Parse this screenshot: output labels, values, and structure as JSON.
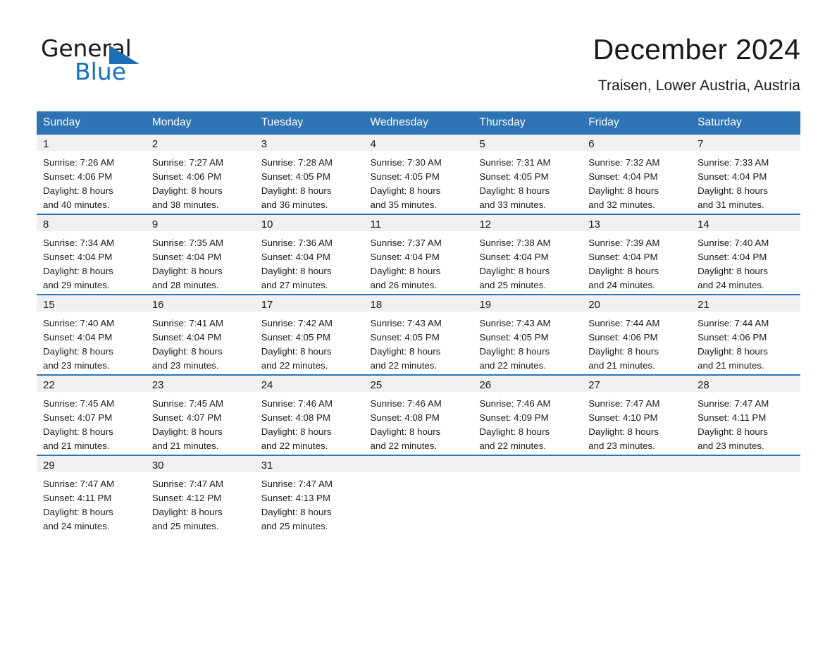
{
  "brand": {
    "name_part1": "General",
    "name_part2": "Blue",
    "accent_color": "#1371c3",
    "flag_color": "#1b6fb4"
  },
  "header": {
    "month_title": "December 2024",
    "location": "Traisen, Lower Austria, Austria"
  },
  "calendar": {
    "header_color": "#2e74b5",
    "date_band_color": "#f0f0f0",
    "weekday_headers": [
      "Sunday",
      "Monday",
      "Tuesday",
      "Wednesday",
      "Thursday",
      "Friday",
      "Saturday"
    ],
    "weeks": [
      [
        {
          "date": "1",
          "detail": "Sunrise: 7:26 AM\nSunset: 4:06 PM\nDaylight: 8 hours\nand 40 minutes."
        },
        {
          "date": "2",
          "detail": "Sunrise: 7:27 AM\nSunset: 4:06 PM\nDaylight: 8 hours\nand 38 minutes."
        },
        {
          "date": "3",
          "detail": "Sunrise: 7:28 AM\nSunset: 4:05 PM\nDaylight: 8 hours\nand 36 minutes."
        },
        {
          "date": "4",
          "detail": "Sunrise: 7:30 AM\nSunset: 4:05 PM\nDaylight: 8 hours\nand 35 minutes."
        },
        {
          "date": "5",
          "detail": "Sunrise: 7:31 AM\nSunset: 4:05 PM\nDaylight: 8 hours\nand 33 minutes."
        },
        {
          "date": "6",
          "detail": "Sunrise: 7:32 AM\nSunset: 4:04 PM\nDaylight: 8 hours\nand 32 minutes."
        },
        {
          "date": "7",
          "detail": "Sunrise: 7:33 AM\nSunset: 4:04 PM\nDaylight: 8 hours\nand 31 minutes."
        }
      ],
      [
        {
          "date": "8",
          "detail": "Sunrise: 7:34 AM\nSunset: 4:04 PM\nDaylight: 8 hours\nand 29 minutes."
        },
        {
          "date": "9",
          "detail": "Sunrise: 7:35 AM\nSunset: 4:04 PM\nDaylight: 8 hours\nand 28 minutes."
        },
        {
          "date": "10",
          "detail": "Sunrise: 7:36 AM\nSunset: 4:04 PM\nDaylight: 8 hours\nand 27 minutes."
        },
        {
          "date": "11",
          "detail": "Sunrise: 7:37 AM\nSunset: 4:04 PM\nDaylight: 8 hours\nand 26 minutes."
        },
        {
          "date": "12",
          "detail": "Sunrise: 7:38 AM\nSunset: 4:04 PM\nDaylight: 8 hours\nand 25 minutes."
        },
        {
          "date": "13",
          "detail": "Sunrise: 7:39 AM\nSunset: 4:04 PM\nDaylight: 8 hours\nand 24 minutes."
        },
        {
          "date": "14",
          "detail": "Sunrise: 7:40 AM\nSunset: 4:04 PM\nDaylight: 8 hours\nand 24 minutes."
        }
      ],
      [
        {
          "date": "15",
          "detail": "Sunrise: 7:40 AM\nSunset: 4:04 PM\nDaylight: 8 hours\nand 23 minutes."
        },
        {
          "date": "16",
          "detail": "Sunrise: 7:41 AM\nSunset: 4:04 PM\nDaylight: 8 hours\nand 23 minutes."
        },
        {
          "date": "17",
          "detail": "Sunrise: 7:42 AM\nSunset: 4:05 PM\nDaylight: 8 hours\nand 22 minutes."
        },
        {
          "date": "18",
          "detail": "Sunrise: 7:43 AM\nSunset: 4:05 PM\nDaylight: 8 hours\nand 22 minutes."
        },
        {
          "date": "19",
          "detail": "Sunrise: 7:43 AM\nSunset: 4:05 PM\nDaylight: 8 hours\nand 22 minutes."
        },
        {
          "date": "20",
          "detail": "Sunrise: 7:44 AM\nSunset: 4:06 PM\nDaylight: 8 hours\nand 21 minutes."
        },
        {
          "date": "21",
          "detail": "Sunrise: 7:44 AM\nSunset: 4:06 PM\nDaylight: 8 hours\nand 21 minutes."
        }
      ],
      [
        {
          "date": "22",
          "detail": "Sunrise: 7:45 AM\nSunset: 4:07 PM\nDaylight: 8 hours\nand 21 minutes."
        },
        {
          "date": "23",
          "detail": "Sunrise: 7:45 AM\nSunset: 4:07 PM\nDaylight: 8 hours\nand 21 minutes."
        },
        {
          "date": "24",
          "detail": "Sunrise: 7:46 AM\nSunset: 4:08 PM\nDaylight: 8 hours\nand 22 minutes."
        },
        {
          "date": "25",
          "detail": "Sunrise: 7:46 AM\nSunset: 4:08 PM\nDaylight: 8 hours\nand 22 minutes."
        },
        {
          "date": "26",
          "detail": "Sunrise: 7:46 AM\nSunset: 4:09 PM\nDaylight: 8 hours\nand 22 minutes."
        },
        {
          "date": "27",
          "detail": "Sunrise: 7:47 AM\nSunset: 4:10 PM\nDaylight: 8 hours\nand 23 minutes."
        },
        {
          "date": "28",
          "detail": "Sunrise: 7:47 AM\nSunset: 4:11 PM\nDaylight: 8 hours\nand 23 minutes."
        }
      ],
      [
        {
          "date": "29",
          "detail": "Sunrise: 7:47 AM\nSunset: 4:11 PM\nDaylight: 8 hours\nand 24 minutes."
        },
        {
          "date": "30",
          "detail": "Sunrise: 7:47 AM\nSunset: 4:12 PM\nDaylight: 8 hours\nand 25 minutes."
        },
        {
          "date": "31",
          "detail": "Sunrise: 7:47 AM\nSunset: 4:13 PM\nDaylight: 8 hours\nand 25 minutes."
        },
        {
          "date": "",
          "detail": ""
        },
        {
          "date": "",
          "detail": ""
        },
        {
          "date": "",
          "detail": ""
        },
        {
          "date": "",
          "detail": ""
        }
      ]
    ]
  }
}
